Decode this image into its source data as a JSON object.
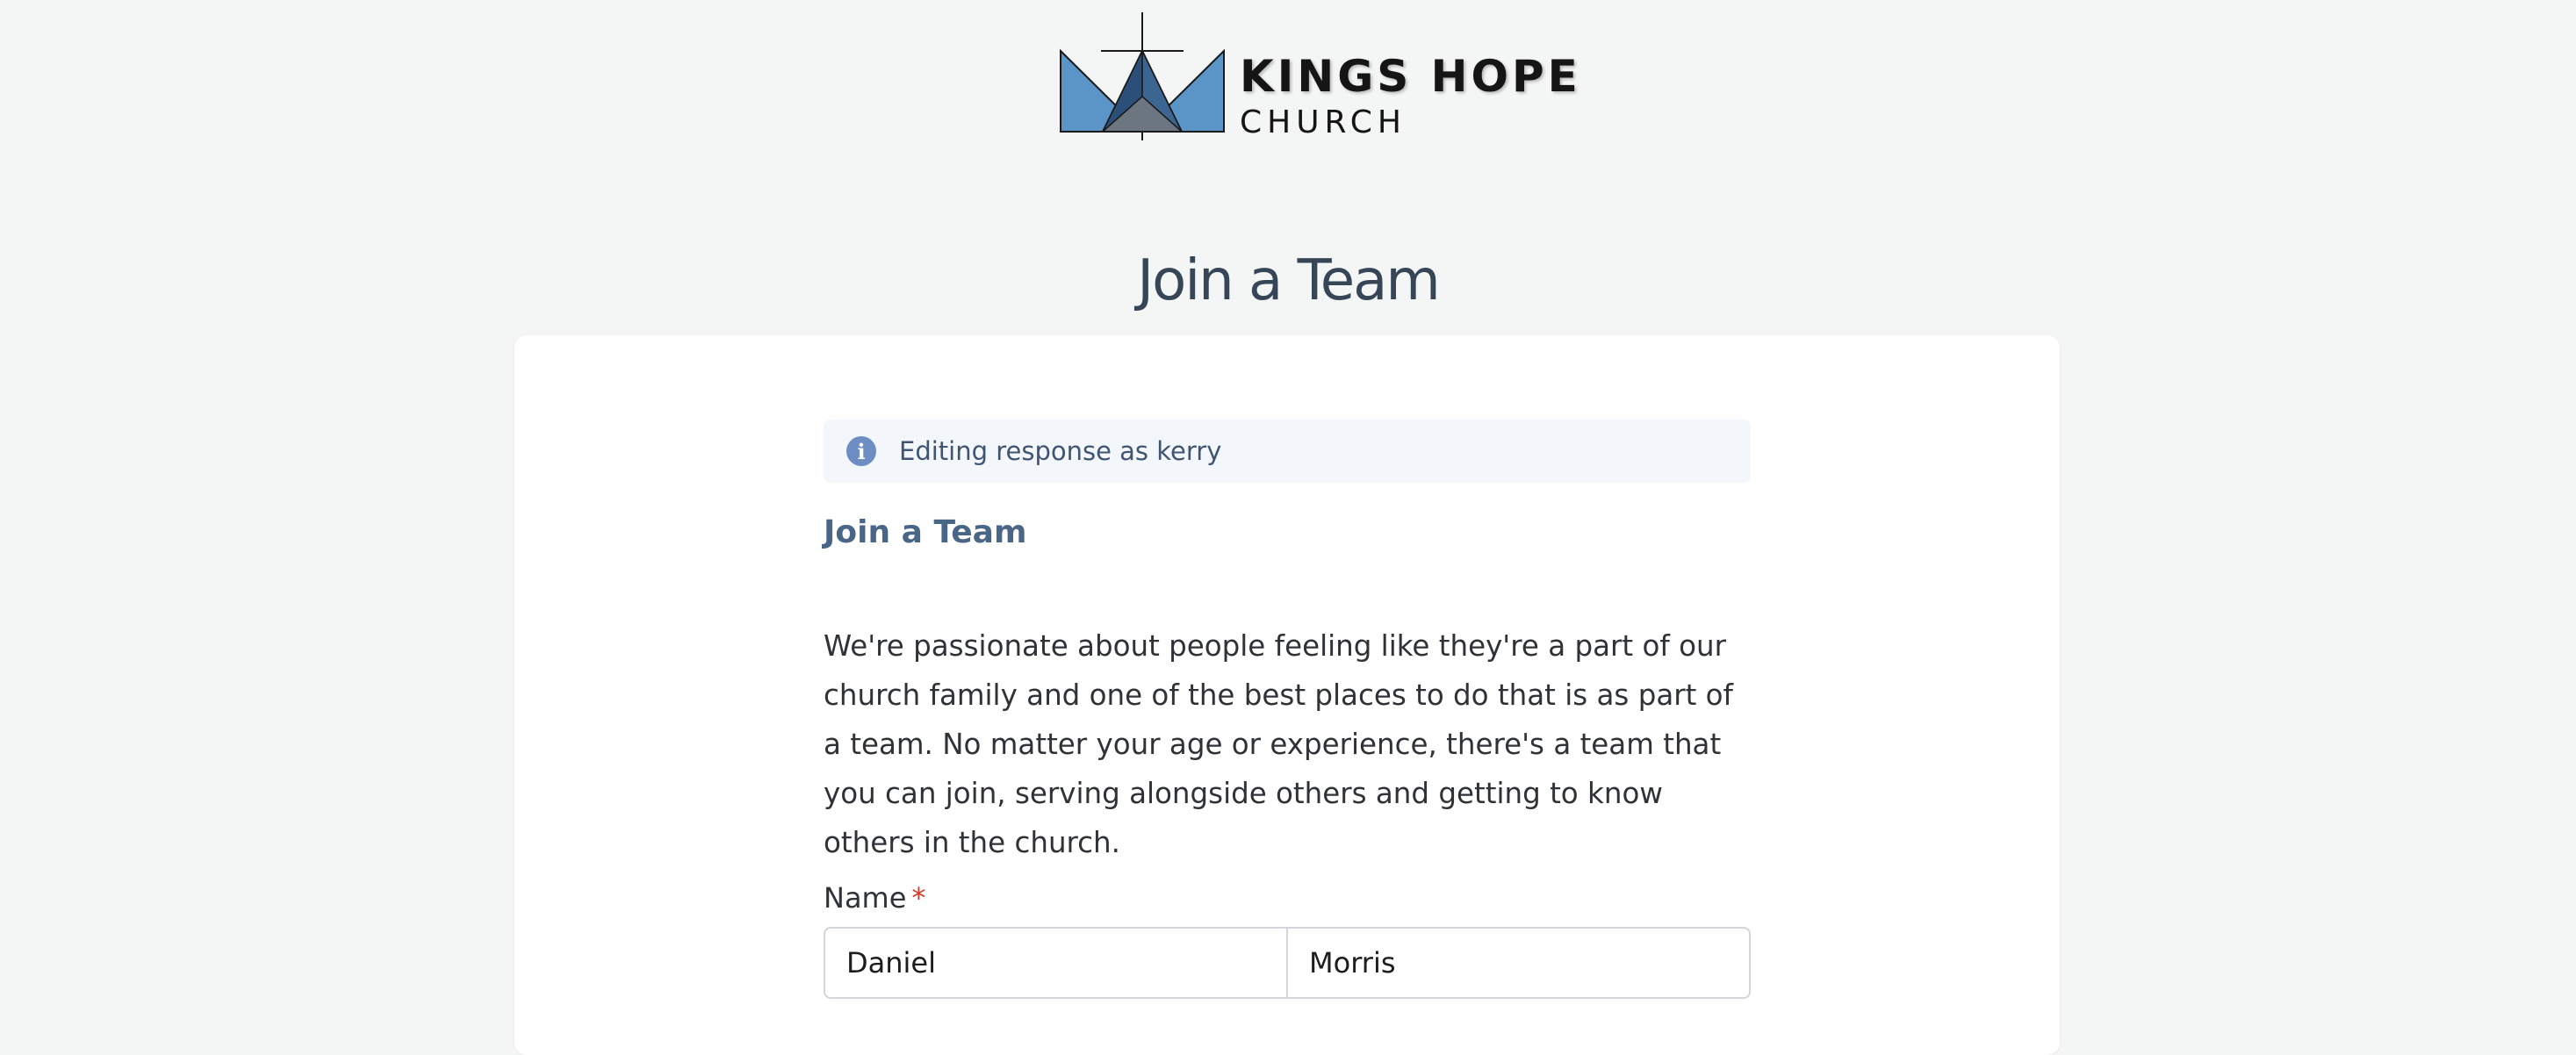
{
  "header": {
    "logo_line1": "KINGS HOPE",
    "logo_line2": "CHURCH",
    "logo_icon": "crown-cross-icon"
  },
  "page": {
    "title": "Join a Team"
  },
  "notice": {
    "icon": "info-icon",
    "text": "Editing response as kerry"
  },
  "form": {
    "section_title": "Join a Team",
    "description": "We're passionate about people feeling like they're a part of our church family and one of the best places to do that is as part of a team. No matter your age or experience, there's a team that you can join, serving alongside others and getting to know others in the church.",
    "name_field": {
      "label": "Name",
      "required_marker": "*",
      "first_name_value": "Daniel",
      "last_name_value": "Morris"
    }
  },
  "colors": {
    "background": "#f4f5f5",
    "card": "#ffffff",
    "title": "#364656",
    "section_title": "#4a6686",
    "notice_bg": "#f3f6fa",
    "info_icon": "#6d8ec3",
    "required": "#d33a2c",
    "logo_blue": "#5b95c8",
    "logo_dark": "#2b4f79"
  }
}
